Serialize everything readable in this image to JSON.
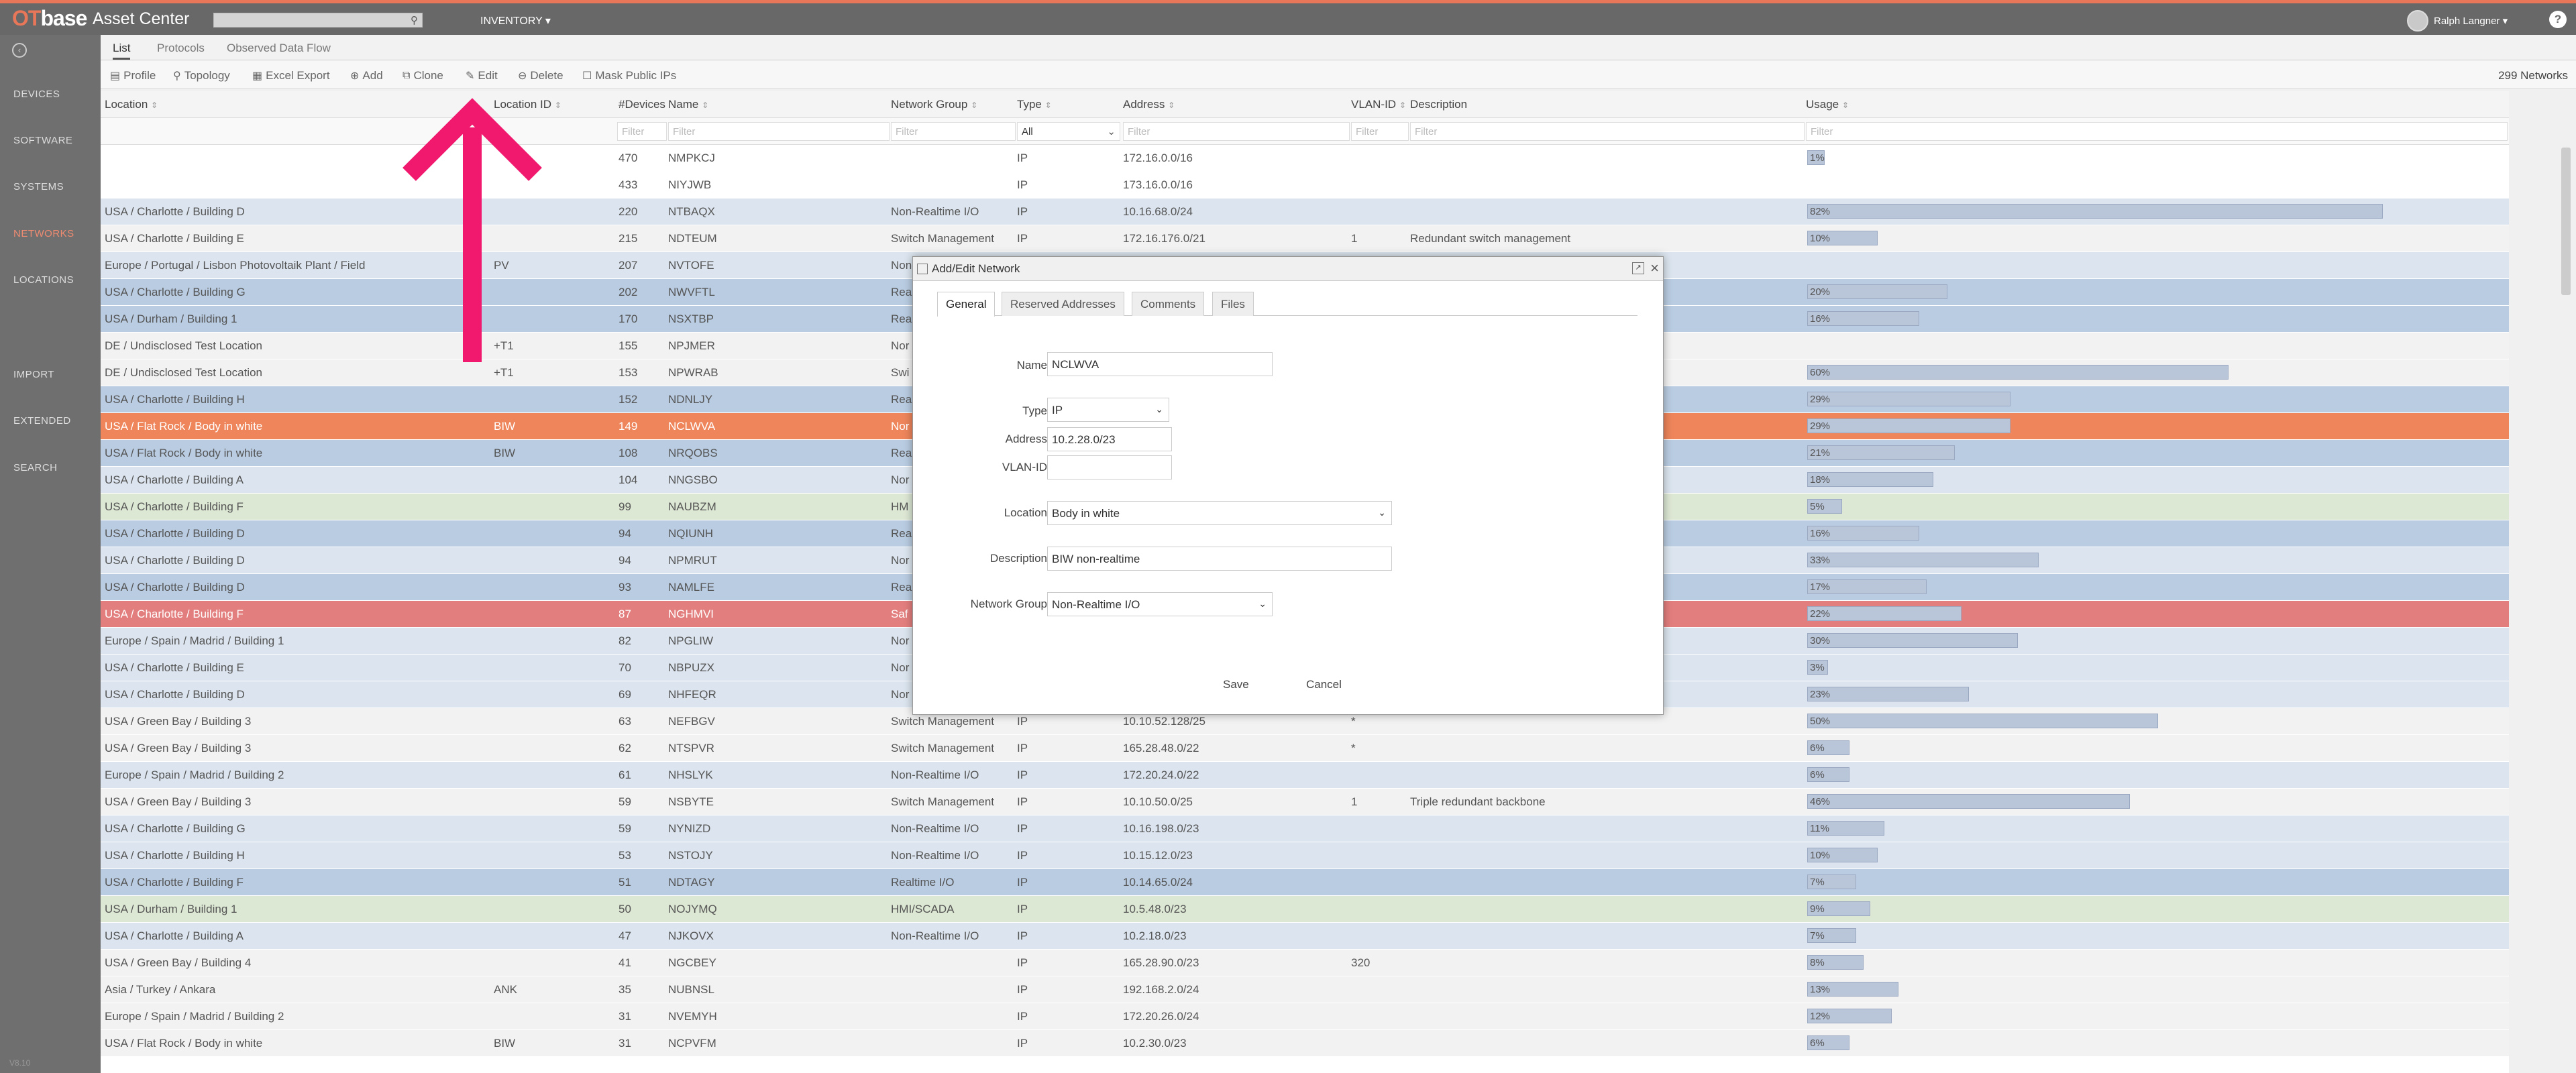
{
  "header": {
    "logo_ot": "OT",
    "logo_base": "base",
    "app_title": "Asset Center",
    "inventory_menu": "INVENTORY ▾",
    "user_name": "Ralph Langner ▾",
    "help": "?"
  },
  "sidebar": {
    "items": [
      {
        "label": "DEVICES"
      },
      {
        "label": "SOFTWARE"
      },
      {
        "label": "SYSTEMS"
      },
      {
        "label": "NETWORKS"
      },
      {
        "label": "LOCATIONS"
      },
      {
        "label": "IMPORT"
      },
      {
        "label": "EXTENDED"
      },
      {
        "label": "SEARCH"
      }
    ],
    "version": "V8.10"
  },
  "tabs": [
    {
      "label": "List"
    },
    {
      "label": "Protocols"
    },
    {
      "label": "Observed Data Flow"
    }
  ],
  "toolbar": {
    "profile": "Profile",
    "topology": "Topology",
    "excel_export": "Excel Export",
    "add": "Add",
    "clone": "Clone",
    "edit": "Edit",
    "delete": "Delete",
    "mask_public_ips": "Mask Public IPs",
    "count": "299 Networks"
  },
  "columns": {
    "location": "Location",
    "location_id": "Location ID",
    "devices": "#Devices",
    "name": "Name",
    "network_group": "Network Group",
    "type": "Type",
    "address": "Address",
    "vlan_id": "VLAN-ID",
    "description": "Description",
    "usage": "Usage"
  },
  "filters": {
    "placeholder": "Filter",
    "type_value": "All"
  },
  "rows": [
    {
      "location": "",
      "loc_id": "",
      "devices": "470",
      "name": "NMPKCJ",
      "group": "",
      "type": "IP",
      "address": "172.16.0.0/16",
      "vlan": "",
      "desc": "",
      "usage": "1%",
      "usage_pct": 1,
      "color": "white"
    },
    {
      "location": "",
      "loc_id": "",
      "devices": "433",
      "name": "NIYJWB",
      "group": "",
      "type": "IP",
      "address": "173.16.0.0/16",
      "vlan": "",
      "desc": "",
      "usage": "",
      "usage_pct": 0,
      "color": "white"
    },
    {
      "location": "USA / Charlotte / Building D",
      "loc_id": "",
      "devices": "220",
      "name": "NTBAQX",
      "group": "Non-Realtime I/O",
      "type": "IP",
      "address": "10.16.68.0/24",
      "vlan": "",
      "desc": "",
      "usage": "82%",
      "usage_pct": 82,
      "color": "bluelight"
    },
    {
      "location": "USA / Charlotte / Building E",
      "loc_id": "",
      "devices": "215",
      "name": "NDTEUM",
      "group": "Switch Management",
      "type": "IP",
      "address": "172.16.176.0/21",
      "vlan": "1",
      "desc": "Redundant switch management",
      "usage": "10%",
      "usage_pct": 10,
      "color": "gray"
    },
    {
      "location": "Europe / Portugal / Lisbon Photovoltaik Plant / Field",
      "loc_id": "PV",
      "devices": "207",
      "name": "NVTOFE",
      "group": "Non",
      "type": "",
      "address": "",
      "vlan": "",
      "desc": "",
      "usage": "",
      "usage_pct": 0,
      "color": "bluelight"
    },
    {
      "location": "USA / Charlotte / Building G",
      "loc_id": "",
      "devices": "202",
      "name": "NWVFTL",
      "group": "Rea",
      "type": "",
      "address": "",
      "vlan": "",
      "desc": "",
      "usage": "20%",
      "usage_pct": 20,
      "color": "blue"
    },
    {
      "location": "USA / Durham / Building 1",
      "loc_id": "",
      "devices": "170",
      "name": "NSXTBP",
      "group": "Rea",
      "type": "",
      "address": "",
      "vlan": "",
      "desc": "",
      "usage": "16%",
      "usage_pct": 16,
      "color": "blue"
    },
    {
      "location": "DE / Undisclosed Test Location",
      "loc_id": "+T1",
      "devices": "155",
      "name": "NPJMER",
      "group": "Nor",
      "type": "",
      "address": "",
      "vlan": "",
      "desc": "",
      "usage": "",
      "usage_pct": 0,
      "color": "gray"
    },
    {
      "location": "DE / Undisclosed Test Location",
      "loc_id": "+T1",
      "devices": "153",
      "name": "NPWRAB",
      "group": "Swi",
      "type": "",
      "address": "",
      "vlan": "",
      "desc": "",
      "usage": "60%",
      "usage_pct": 60,
      "color": "gray"
    },
    {
      "location": "USA / Charlotte / Building H",
      "loc_id": "",
      "devices": "152",
      "name": "NDNLJY",
      "group": "Rea",
      "type": "",
      "address": "",
      "vlan": "",
      "desc": "",
      "usage": "29%",
      "usage_pct": 29,
      "color": "blue"
    },
    {
      "location": "USA / Flat Rock / Body in white",
      "loc_id": "BIW",
      "devices": "149",
      "name": "NCLWVA",
      "group": "Nor",
      "type": "",
      "address": "",
      "vlan": "",
      "desc": "",
      "usage": "29%",
      "usage_pct": 29,
      "color": "orange"
    },
    {
      "location": "USA / Flat Rock / Body in white",
      "loc_id": "BIW",
      "devices": "108",
      "name": "NRQOBS",
      "group": "Rea",
      "type": "",
      "address": "",
      "vlan": "",
      "desc": "",
      "usage": "21%",
      "usage_pct": 21,
      "color": "blue"
    },
    {
      "location": "USA / Charlotte / Building A",
      "loc_id": "",
      "devices": "104",
      "name": "NNGSBO",
      "group": "Nor",
      "type": "",
      "address": "",
      "vlan": "",
      "desc": "",
      "usage": "18%",
      "usage_pct": 18,
      "color": "bluelight"
    },
    {
      "location": "USA / Charlotte / Building F",
      "loc_id": "",
      "devices": "99",
      "name": "NAUBZM",
      "group": "HM",
      "type": "",
      "address": "",
      "vlan": "",
      "desc": "",
      "usage": "5%",
      "usage_pct": 5,
      "color": "green"
    },
    {
      "location": "USA / Charlotte / Building D",
      "loc_id": "",
      "devices": "94",
      "name": "NQIUNH",
      "group": "Rea",
      "type": "",
      "address": "",
      "vlan": "",
      "desc": "",
      "usage": "16%",
      "usage_pct": 16,
      "color": "blue"
    },
    {
      "location": "USA / Charlotte / Building D",
      "loc_id": "",
      "devices": "94",
      "name": "NPMRUT",
      "group": "Nor",
      "type": "",
      "address": "",
      "vlan": "",
      "desc": "",
      "usage": "33%",
      "usage_pct": 33,
      "color": "bluelight"
    },
    {
      "location": "USA / Charlotte / Building D",
      "loc_id": "",
      "devices": "93",
      "name": "NAMLFE",
      "group": "Rea",
      "type": "",
      "address": "",
      "vlan": "",
      "desc": "",
      "usage": "17%",
      "usage_pct": 17,
      "color": "blue"
    },
    {
      "location": "USA / Charlotte / Building F",
      "loc_id": "",
      "devices": "87",
      "name": "NGHMVI",
      "group": "Saf",
      "type": "",
      "address": "",
      "vlan": "",
      "desc": "",
      "usage": "22%",
      "usage_pct": 22,
      "color": "red"
    },
    {
      "location": "Europe / Spain / Madrid / Building 1",
      "loc_id": "",
      "devices": "82",
      "name": "NPGLIW",
      "group": "Nor",
      "type": "",
      "address": "",
      "vlan": "",
      "desc": "",
      "usage": "30%",
      "usage_pct": 30,
      "color": "bluelight"
    },
    {
      "location": "USA / Charlotte / Building E",
      "loc_id": "",
      "devices": "70",
      "name": "NBPUZX",
      "group": "Nor",
      "type": "",
      "address": "",
      "vlan": "",
      "desc": "",
      "usage": "3%",
      "usage_pct": 3,
      "color": "bluelight"
    },
    {
      "location": "USA / Charlotte / Building D",
      "loc_id": "",
      "devices": "69",
      "name": "NHFEQR",
      "group": "Nor",
      "type": "",
      "address": "",
      "vlan": "",
      "desc": "",
      "usage": "23%",
      "usage_pct": 23,
      "color": "bluelight"
    },
    {
      "location": "USA / Green Bay / Building 3",
      "loc_id": "",
      "devices": "63",
      "name": "NEFBGV",
      "group": "Switch Management",
      "type": "IP",
      "address": "10.10.52.128/25",
      "vlan": "*",
      "desc": "",
      "usage": "50%",
      "usage_pct": 50,
      "color": "gray"
    },
    {
      "location": "USA / Green Bay / Building 3",
      "loc_id": "",
      "devices": "62",
      "name": "NTSPVR",
      "group": "Switch Management",
      "type": "IP",
      "address": "165.28.48.0/22",
      "vlan": "*",
      "desc": "",
      "usage": "6%",
      "usage_pct": 6,
      "color": "gray"
    },
    {
      "location": "Europe / Spain / Madrid / Building 2",
      "loc_id": "",
      "devices": "61",
      "name": "NHSLYK",
      "group": "Non-Realtime I/O",
      "type": "IP",
      "address": "172.20.24.0/22",
      "vlan": "",
      "desc": "",
      "usage": "6%",
      "usage_pct": 6,
      "color": "bluelight"
    },
    {
      "location": "USA / Green Bay / Building 3",
      "loc_id": "",
      "devices": "59",
      "name": "NSBYTE",
      "group": "Switch Management",
      "type": "IP",
      "address": "10.10.50.0/25",
      "vlan": "1",
      "desc": "Triple redundant backbone",
      "usage": "46%",
      "usage_pct": 46,
      "color": "gray"
    },
    {
      "location": "USA / Charlotte / Building G",
      "loc_id": "",
      "devices": "59",
      "name": "NYNIZD",
      "group": "Non-Realtime I/O",
      "type": "IP",
      "address": "10.16.198.0/23",
      "vlan": "",
      "desc": "",
      "usage": "11%",
      "usage_pct": 11,
      "color": "bluelight"
    },
    {
      "location": "USA / Charlotte / Building H",
      "loc_id": "",
      "devices": "53",
      "name": "NSTOJY",
      "group": "Non-Realtime I/O",
      "type": "IP",
      "address": "10.15.12.0/23",
      "vlan": "",
      "desc": "",
      "usage": "10%",
      "usage_pct": 10,
      "color": "bluelight"
    },
    {
      "location": "USA / Charlotte / Building F",
      "loc_id": "",
      "devices": "51",
      "name": "NDTAGY",
      "group": "Realtime I/O",
      "type": "IP",
      "address": "10.14.65.0/24",
      "vlan": "",
      "desc": "",
      "usage": "7%",
      "usage_pct": 7,
      "color": "blue"
    },
    {
      "location": "USA / Durham / Building 1",
      "loc_id": "",
      "devices": "50",
      "name": "NOJYMQ",
      "group": "HMI/SCADA",
      "type": "IP",
      "address": "10.5.48.0/23",
      "vlan": "",
      "desc": "",
      "usage": "9%",
      "usage_pct": 9,
      "color": "green"
    },
    {
      "location": "USA / Charlotte / Building A",
      "loc_id": "",
      "devices": "47",
      "name": "NJKOVX",
      "group": "Non-Realtime I/O",
      "type": "IP",
      "address": "10.2.18.0/23",
      "vlan": "",
      "desc": "",
      "usage": "7%",
      "usage_pct": 7,
      "color": "bluelight"
    },
    {
      "location": "USA / Green Bay / Building 4",
      "loc_id": "",
      "devices": "41",
      "name": "NGCBEY",
      "group": "",
      "type": "IP",
      "address": "165.28.90.0/23",
      "vlan": "320",
      "desc": "",
      "usage": "8%",
      "usage_pct": 8,
      "color": "gray"
    },
    {
      "location": "Asia / Turkey / Ankara",
      "loc_id": "ANK",
      "devices": "35",
      "name": "NUBNSL",
      "group": "",
      "type": "IP",
      "address": "192.168.2.0/24",
      "vlan": "",
      "desc": "",
      "usage": "13%",
      "usage_pct": 13,
      "color": "gray"
    },
    {
      "location": "Europe / Spain / Madrid / Building 2",
      "loc_id": "",
      "devices": "31",
      "name": "NVEMYH",
      "group": "",
      "type": "IP",
      "address": "172.20.26.0/24",
      "vlan": "",
      "desc": "",
      "usage": "12%",
      "usage_pct": 12,
      "color": "gray"
    },
    {
      "location": "USA / Flat Rock / Body in white",
      "loc_id": "BIW",
      "devices": "31",
      "name": "NCPVFM",
      "group": "",
      "type": "IP",
      "address": "10.2.30.0/23",
      "vlan": "",
      "desc": "",
      "usage": "6%",
      "usage_pct": 6,
      "color": "gray"
    }
  ],
  "dialog": {
    "title": "Add/Edit Network",
    "close": "×",
    "tabs": [
      {
        "label": "General"
      },
      {
        "label": "Reserved Addresses"
      },
      {
        "label": "Comments"
      },
      {
        "label": "Files"
      }
    ],
    "fields": {
      "name_label": "Name",
      "name_value": "NCLWVA",
      "type_label": "Type",
      "type_value": "IP",
      "address_label": "Address",
      "address_value": "10.2.28.0/23",
      "vlan_label": "VLAN-ID",
      "vlan_value": "",
      "location_label": "Location",
      "location_value": "Body in white",
      "description_label": "Description",
      "description_value": "BIW non-realtime",
      "network_group_label": "Network Group",
      "network_group_value": "Non-Realtime I/O"
    },
    "save": "Save",
    "cancel": "Cancel"
  },
  "colors": {
    "accent": "#e8775a",
    "highlight_arrow": "#f0196e",
    "row_orange": "#ee855b",
    "row_red": "#e37e7e",
    "row_blue": "#b9cce2",
    "row_bluelight": "#dce5ef",
    "row_green": "#dde8d4"
  }
}
